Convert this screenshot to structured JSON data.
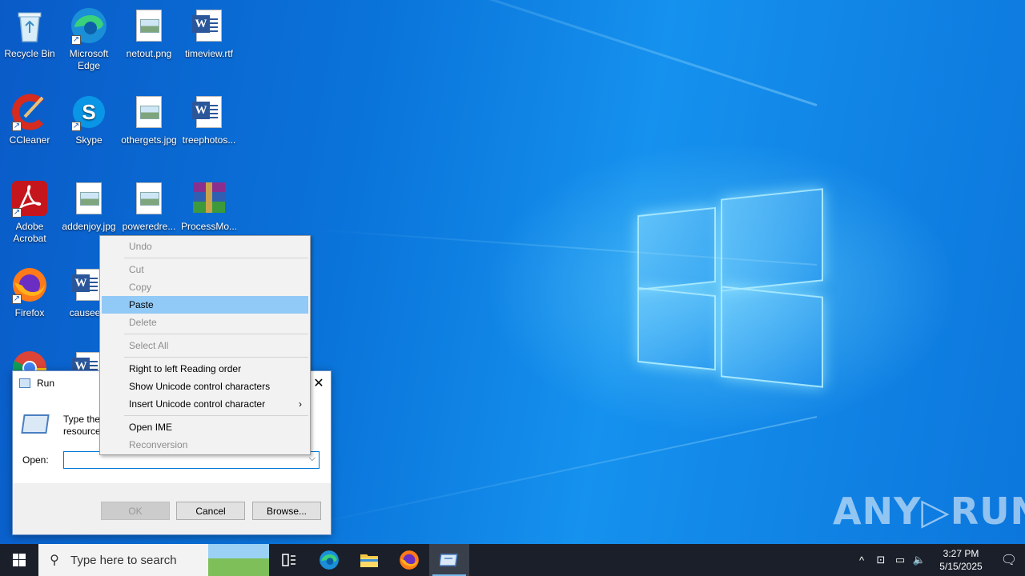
{
  "desktop_icons": [
    {
      "label": "Recycle Bin",
      "icon": "recycle-bin-icon"
    },
    {
      "label": "Microsoft Edge",
      "icon": "edge-icon"
    },
    {
      "label": "netout.png",
      "icon": "image-file-icon"
    },
    {
      "label": "timeview.rtf",
      "icon": "word-doc-icon"
    },
    {
      "label": "CCleaner",
      "icon": "ccleaner-icon"
    },
    {
      "label": "Skype",
      "icon": "skype-icon"
    },
    {
      "label": "othergets.jpg",
      "icon": "image-file-icon"
    },
    {
      "label": "treephotos...",
      "icon": "word-doc-icon"
    },
    {
      "label": "Adobe Acrobat",
      "icon": "acrobat-icon"
    },
    {
      "label": "addenjoy.jpg",
      "icon": "image-file-icon"
    },
    {
      "label": "poweredre...",
      "icon": "image-file-icon"
    },
    {
      "label": "ProcessMo...",
      "icon": "winrar-icon"
    },
    {
      "label": "Firefox",
      "icon": "firefox-icon"
    },
    {
      "label": "causeem",
      "icon": "word-doc-icon"
    },
    {
      "label": "",
      "icon": "chrome-icon"
    },
    {
      "label": "",
      "icon": "word-doc-icon"
    }
  ],
  "run_dialog": {
    "title": "Run",
    "description_line1": "Type the",
    "description_line2": "resource",
    "open_label": "Open:",
    "open_value": "",
    "ok_label": "OK",
    "cancel_label": "Cancel",
    "browse_label": "Browse...",
    "close_glyph": "✕"
  },
  "context_menu": {
    "undo": "Undo",
    "cut": "Cut",
    "copy": "Copy",
    "paste": "Paste",
    "delete": "Delete",
    "select_all": "Select All",
    "rtl": "Right to left Reading order",
    "show_unicode": "Show Unicode control characters",
    "insert_unicode": "Insert Unicode control character",
    "open_ime": "Open IME",
    "reconversion": "Reconversion"
  },
  "taskbar": {
    "search_placeholder": "Type here to search",
    "time": "3:27 PM",
    "date": "5/15/2025"
  },
  "watermark": "ANY▷RUN",
  "colors": {
    "menu_highlight": "#91c9f7",
    "taskbar": "#1b1f2a",
    "accent": "#0078d7"
  }
}
